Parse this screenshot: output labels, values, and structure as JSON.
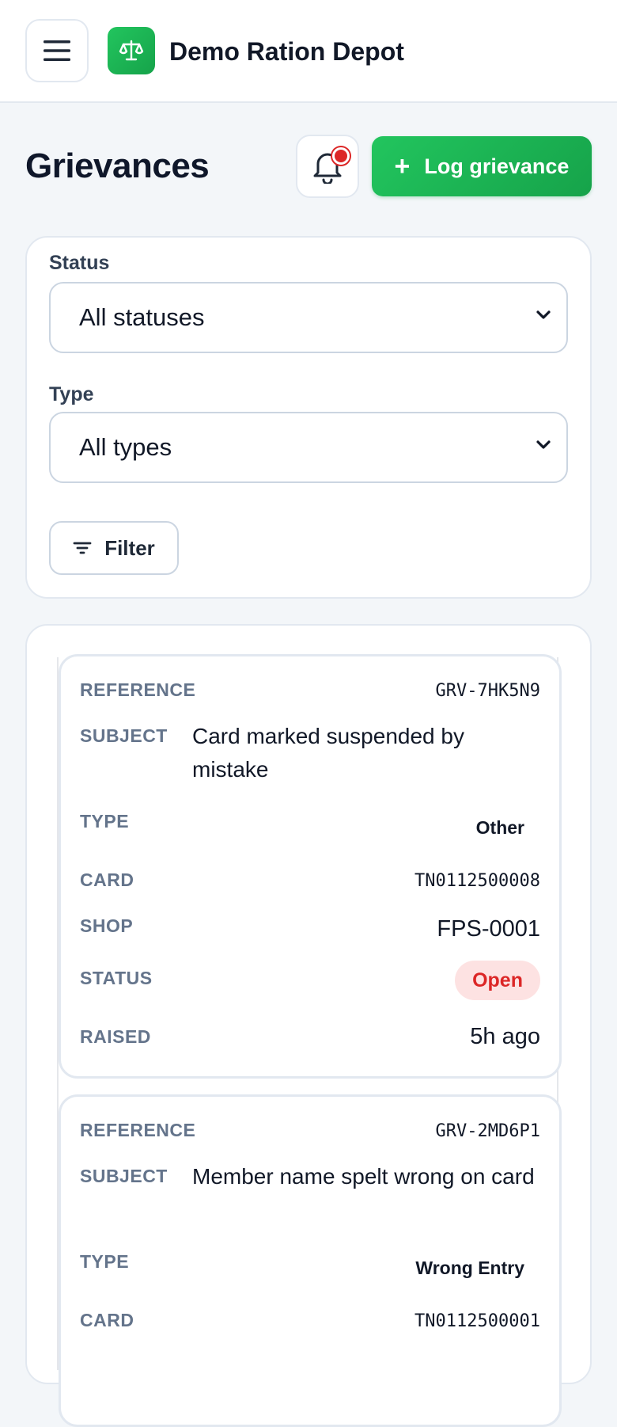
{
  "app": {
    "name": "Demo Ration Depot"
  },
  "header": {
    "menu_icon": "hamburger-menu-icon",
    "logo_icon": "balance-scale-icon"
  },
  "page": {
    "title": "Grievances",
    "notifications_icon": "bell-icon",
    "log_button": {
      "icon": "+",
      "label": "Log grievance"
    }
  },
  "filters": {
    "status": {
      "label": "Status",
      "value": "All statuses"
    },
    "type": {
      "label": "Type",
      "value": "All types"
    },
    "filter_button": {
      "label": "Filter",
      "icon": "filter-lines-icon"
    }
  },
  "labels": {
    "reference": "Reference",
    "subject": "Subject",
    "type": "Type",
    "card": "Card",
    "shop": "Shop",
    "status": "Status",
    "raised": "Raised"
  },
  "grievances": [
    {
      "reference": "GRV-7HK5N9",
      "subject": "Card marked suspended by mistake",
      "type": "Other",
      "card": "TN0112500008",
      "shop": "FPS-0001",
      "status": "Open",
      "raised": "5h ago"
    },
    {
      "reference": "GRV-2MD6P1",
      "subject": "Member name spelt wrong on card",
      "type": "Wrong Entry",
      "card": "TN0112500001"
    }
  ],
  "colors": {
    "accent": "#16a34a",
    "status_open_bg": "#fde2e2",
    "status_open_text": "#dc2626"
  }
}
